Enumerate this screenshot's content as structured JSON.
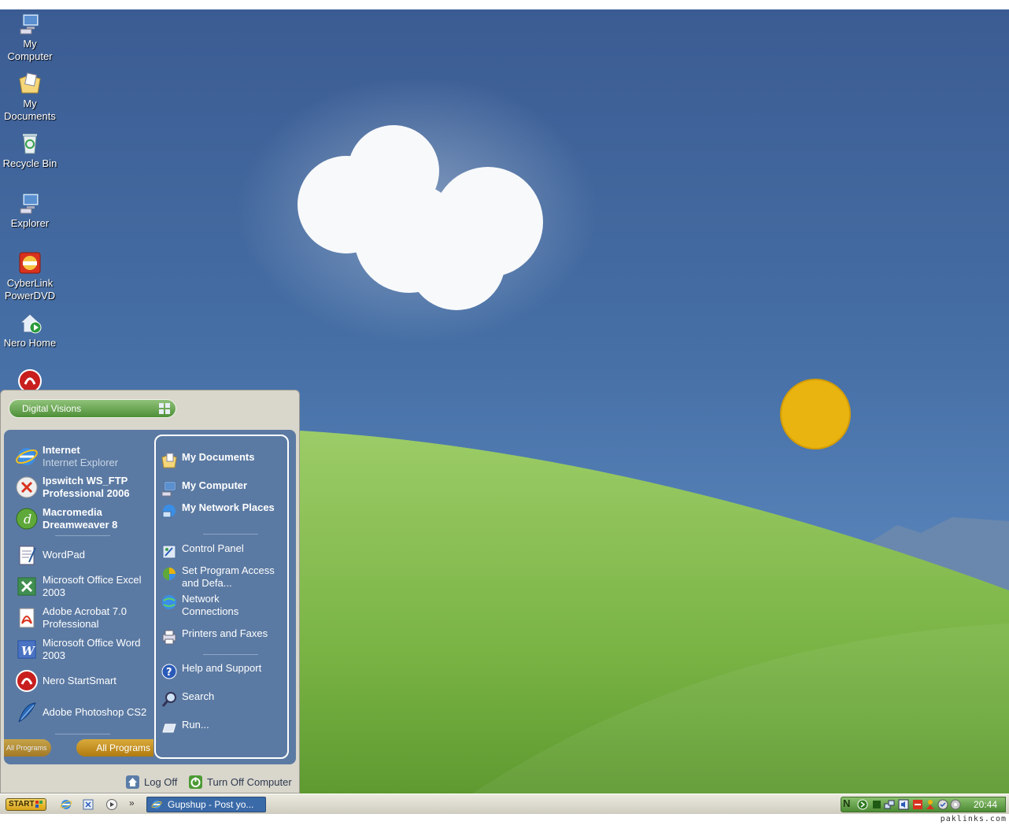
{
  "desktop": {
    "icons": [
      {
        "label": "My Computer",
        "icon": "my-computer-icon"
      },
      {
        "label": "My Documents",
        "icon": "my-documents-icon"
      },
      {
        "label": "Recycle Bin",
        "icon": "recycle-bin-icon"
      },
      {
        "label": "Explorer",
        "icon": "explorer-icon"
      },
      {
        "label": "CyberLink PowerDVD",
        "icon": "powerdvd-icon"
      },
      {
        "label": "Nero Home",
        "icon": "nero-home-icon"
      }
    ]
  },
  "start_menu": {
    "user_name": "Digital Visions",
    "pinned": [
      {
        "title": "Internet",
        "subtitle": "Internet Explorer",
        "icon": "internet-explorer-icon"
      },
      {
        "title": "Ipswitch WS_FTP Professional 2006",
        "icon": "ws-ftp-icon"
      },
      {
        "title": "Macromedia Dreamweaver 8",
        "icon": "dreamweaver-icon"
      }
    ],
    "recent": [
      {
        "title": "WordPad",
        "icon": "wordpad-icon"
      },
      {
        "title": "Microsoft Office Excel 2003",
        "icon": "excel-icon"
      },
      {
        "title": "Adobe Acrobat 7.0 Professional",
        "icon": "acrobat-icon"
      },
      {
        "title": "Microsoft Office Word 2003",
        "icon": "word-icon"
      },
      {
        "title": "Nero StartSmart",
        "icon": "nero-icon"
      },
      {
        "title": "Adobe Photoshop CS2",
        "icon": "photoshop-icon"
      }
    ],
    "all_programs_label": "All Programs",
    "all_programs_ghost_label": "All Programs",
    "places": [
      {
        "title": "My Documents",
        "bold": true,
        "icon": "my-documents-icon"
      },
      {
        "title": "My Computer",
        "bold": true,
        "icon": "my-computer-icon"
      },
      {
        "title": "My Network Places",
        "bold": true,
        "icon": "network-places-icon"
      },
      {
        "title": "Control Panel",
        "bold": false,
        "icon": "control-panel-icon"
      },
      {
        "title": "Set Program Access and Defa...",
        "bold": false,
        "icon": "program-access-icon"
      },
      {
        "title": "Network Connections",
        "bold": false,
        "icon": "network-connections-icon"
      },
      {
        "title": "Printers and Faxes",
        "bold": false,
        "icon": "printer-icon"
      },
      {
        "title": "Help and Support",
        "bold": false,
        "icon": "help-icon"
      },
      {
        "title": "Search",
        "bold": false,
        "icon": "search-icon"
      },
      {
        "title": "Run...",
        "bold": false,
        "icon": "run-icon"
      }
    ],
    "log_off_label": "Log Off",
    "turn_off_label": "Turn Off Computer"
  },
  "taskbar": {
    "start_label": "START",
    "quick_launch": [
      "internet-explorer-icon",
      "outlook-express-icon",
      "media-player-icon"
    ],
    "overflow_label": "»",
    "tasks": [
      {
        "label": "Gupshup - Post yo...",
        "icon": "internet-explorer-icon"
      }
    ],
    "tray_icons": [
      "nero-scout-icon",
      "arrow-icon",
      "display-icon",
      "network-icon",
      "volume-icon",
      "antivirus-icon",
      "user-icon",
      "shield-icon",
      "disk-icon"
    ],
    "tray_badge": "N",
    "clock": "20:44"
  },
  "watermark": "paklinks.com",
  "colors": {
    "sky": "#4670a6",
    "hill": "#7cb342",
    "sun": "#e8b20e",
    "start_menu_body": "#5b7aa3"
  }
}
